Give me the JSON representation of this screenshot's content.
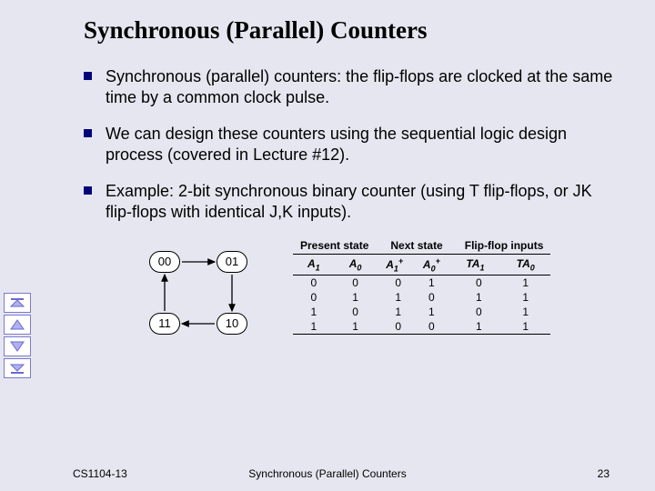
{
  "title": "Synchronous (Parallel) Counters",
  "bullets": {
    "b1": "Synchronous (parallel) counters: the flip-flops are clocked at the same time by a common clock pulse.",
    "b2": "We can design these counters using the sequential logic design process (covered in Lecture #12).",
    "b3": "Example: 2-bit synchronous binary counter (using T flip-flops, or JK flip-flops with identical J,K inputs)."
  },
  "states": {
    "s00": "00",
    "s01": "01",
    "s10": "10",
    "s11": "11"
  },
  "table": {
    "group_headers": [
      "Present state",
      "Next state",
      "Flip-flop inputs"
    ],
    "col_headers": [
      "A1",
      "A0",
      "A1+",
      "A0+",
      "TA1",
      "TA0"
    ],
    "rows": [
      [
        "0",
        "0",
        "0",
        "1",
        "0",
        "1"
      ],
      [
        "0",
        "1",
        "1",
        "0",
        "1",
        "1"
      ],
      [
        "1",
        "0",
        "1",
        "1",
        "0",
        "1"
      ],
      [
        "1",
        "1",
        "0",
        "0",
        "1",
        "1"
      ]
    ]
  },
  "footer": {
    "left": "CS1104-13",
    "center": "Synchronous (Parallel) Counters",
    "right": "23"
  },
  "nav": {
    "first": "first-slide",
    "prev": "prev-slide",
    "next": "next-slide",
    "last": "last-slide"
  }
}
